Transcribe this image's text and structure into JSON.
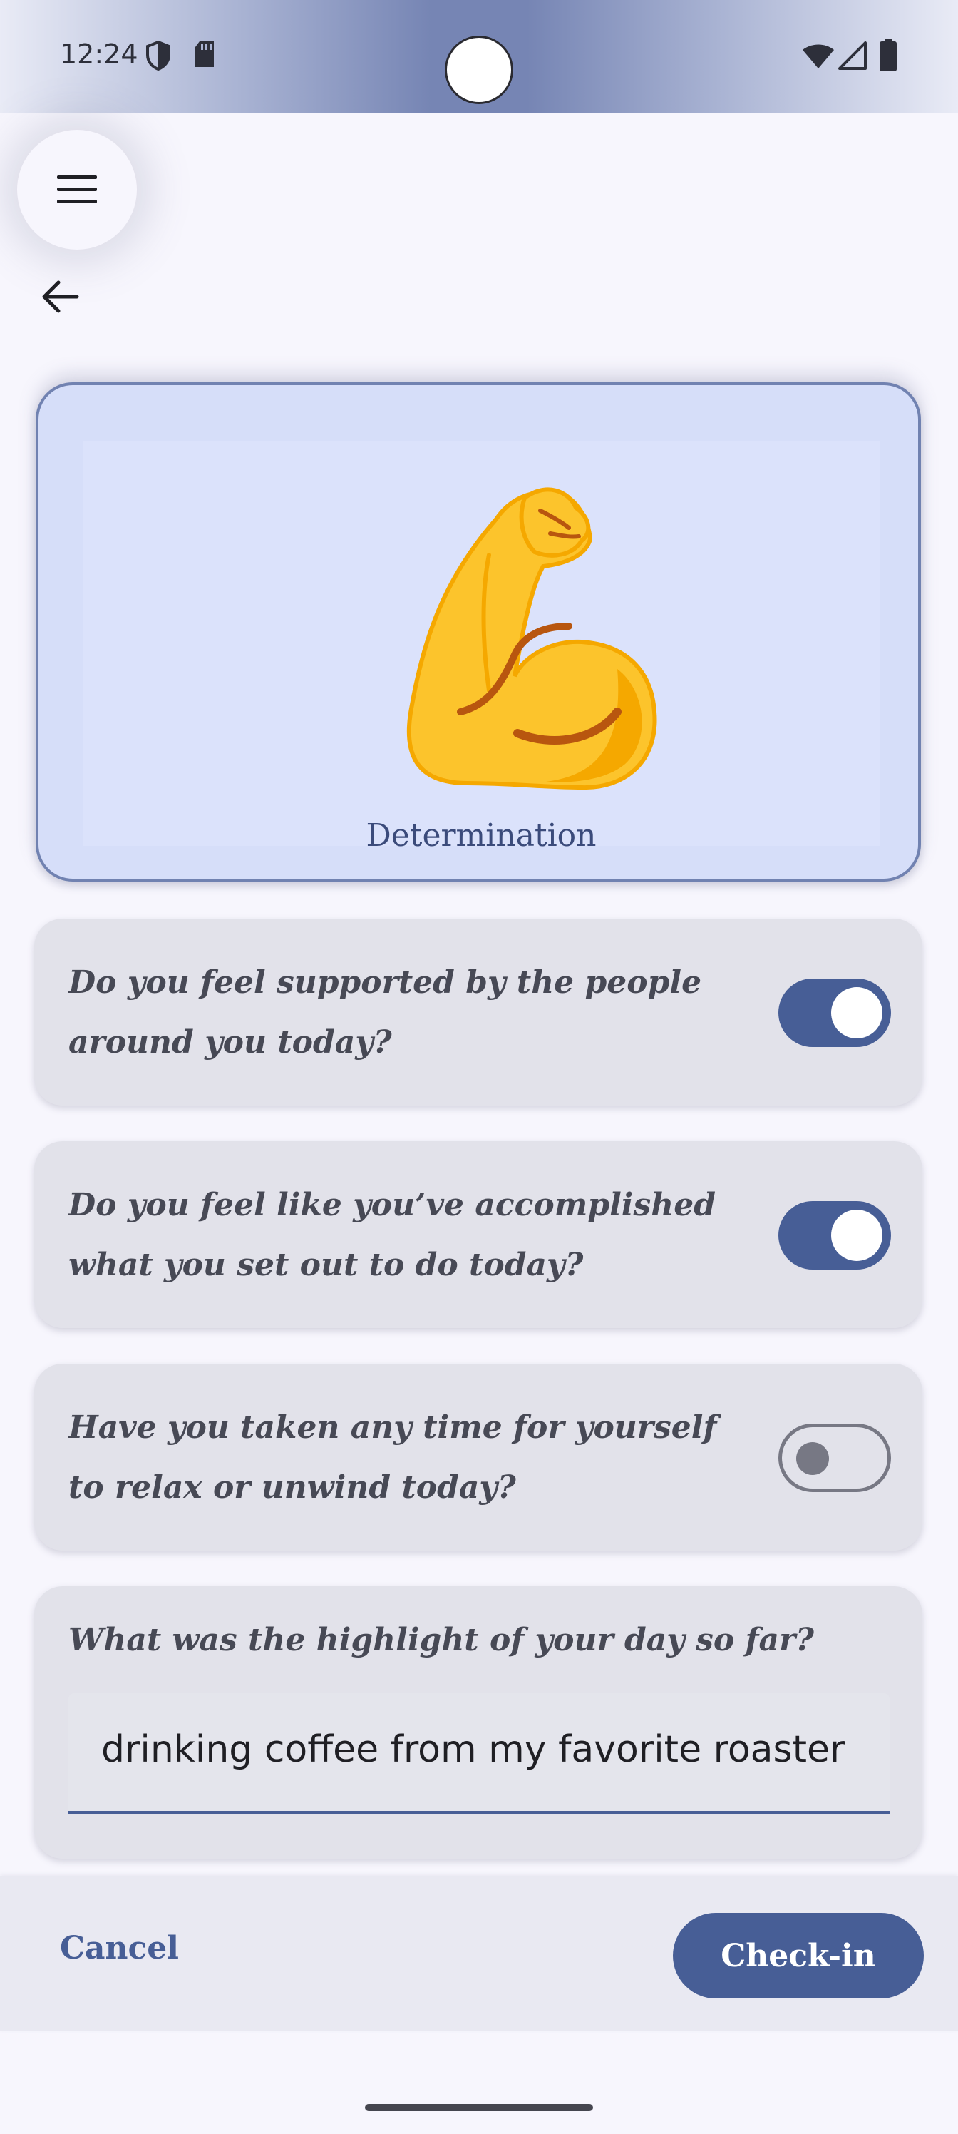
{
  "status_bar": {
    "time": "12:24",
    "left_icons": [
      "shield-icon",
      "sd-card-icon"
    ],
    "right_icons": [
      "wifi-icon",
      "signal-icon",
      "battery-icon"
    ]
  },
  "nav": {
    "menu_icon": "hamburger-menu-icon",
    "back_icon": "arrow-back-icon"
  },
  "emotion": {
    "emoji": "flexed-biceps",
    "label": "Determination"
  },
  "questions": [
    {
      "text": "Do you feel supported by the people around you today?",
      "checked": true
    },
    {
      "text": "Do you feel like you’ve accomplished what you set out to do today?",
      "checked": true
    },
    {
      "text": "Have you taken any time for yourself to relax or unwind today?",
      "checked": false
    }
  ],
  "highlight": {
    "question": "What was the highlight of your day so far?",
    "value": "drinking coffee from my favorite roaster"
  },
  "actions": {
    "cancel_label": "Cancel",
    "checkin_label": "Check-in"
  },
  "colors": {
    "primary": "#475e96",
    "card_bg": "#e2e2ea",
    "emotion_card_bg": "#d6def9",
    "page_bg": "#f7f6fd"
  }
}
